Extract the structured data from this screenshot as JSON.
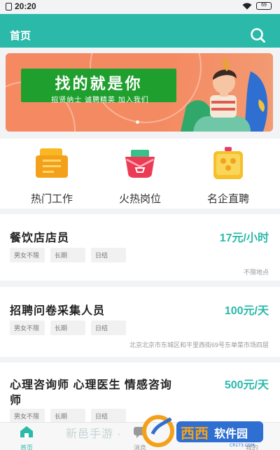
{
  "status": {
    "time": "20:20",
    "battery": "69"
  },
  "header": {
    "title": "首页"
  },
  "banner": {
    "headline": "找的就是你",
    "tagline": "招贤纳士 诚聘精英 加入我们"
  },
  "categories": [
    {
      "label": "热门工作",
      "icon": "briefcase-icon"
    },
    {
      "label": "火热岗位",
      "icon": "cart-icon"
    },
    {
      "label": "名企直聘",
      "icon": "building-icon"
    }
  ],
  "jobs": [
    {
      "title": "餐饮店店员",
      "pay": "17元/小时",
      "tags": [
        "男女不限",
        "长期",
        "日结"
      ],
      "address": "不限地点"
    },
    {
      "title": "招聘问卷采集人员",
      "pay": "100元/天",
      "tags": [
        "男女不限",
        "长期",
        "日结"
      ],
      "address": "北京北京市东城区和平里西街69号东单菜市场四层"
    },
    {
      "title": "心理咨询师 心理医生 情感咨询师",
      "title_line1": "心理咨询师 心理医生 情感咨询",
      "title_line2": "师",
      "pay": "500元/天",
      "tags": [
        "男女不限",
        "长期",
        "日结"
      ]
    }
  ],
  "tabs": [
    {
      "label": "首页"
    },
    {
      "label": "消息"
    },
    {
      "label": "我的"
    }
  ],
  "watermark": {
    "text": "新邑手游 ·",
    "logo_text": "西西软件园",
    "logo_url": "CR173.COM"
  },
  "colors": {
    "accent": "#2bb9aa",
    "banner": "#f58a62",
    "banner_card": "#1f9f2e"
  }
}
